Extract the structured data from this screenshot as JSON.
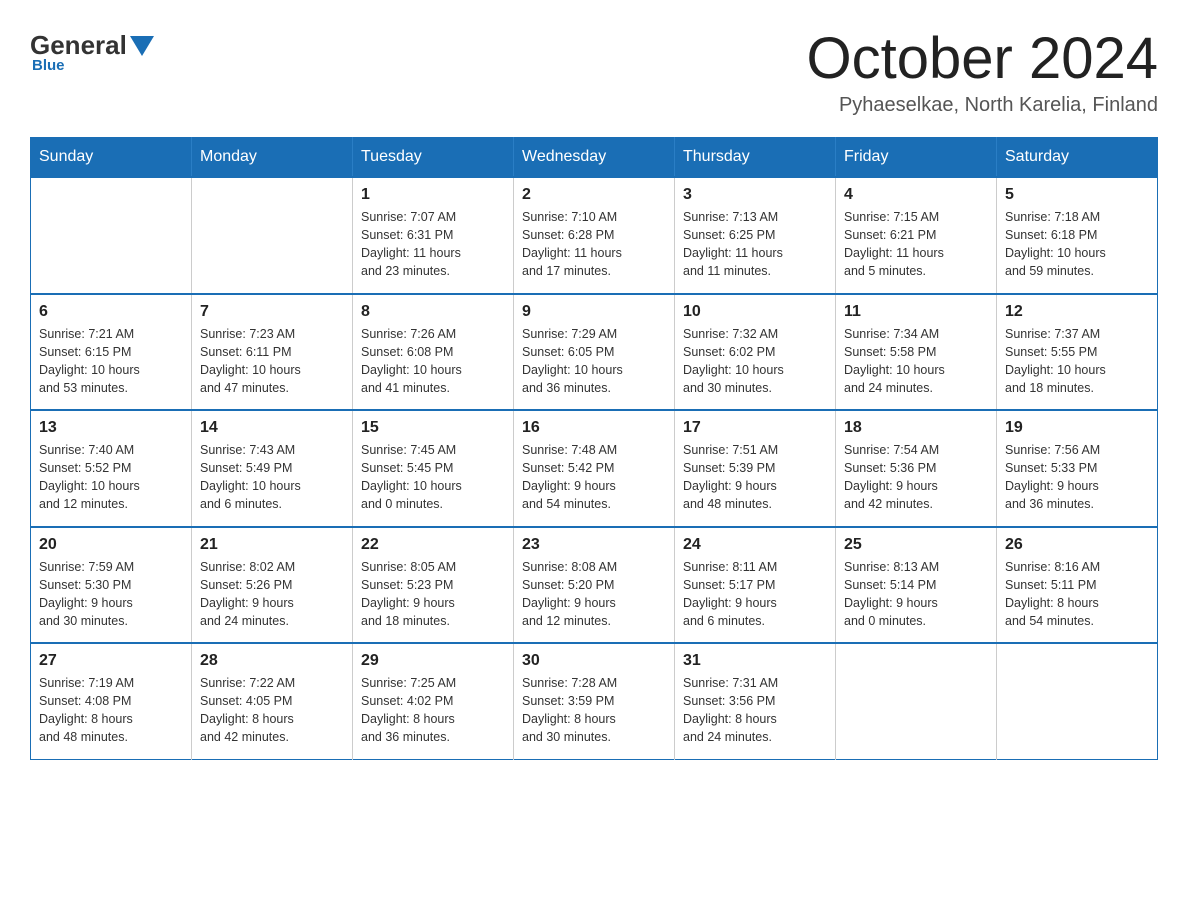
{
  "logo": {
    "general": "General",
    "blue": "Blue",
    "underline": "Blue"
  },
  "title": "October 2024",
  "subtitle": "Pyhaeselkae, North Karelia, Finland",
  "days_of_week": [
    "Sunday",
    "Monday",
    "Tuesday",
    "Wednesday",
    "Thursday",
    "Friday",
    "Saturday"
  ],
  "weeks": [
    [
      {
        "day": "",
        "info": ""
      },
      {
        "day": "",
        "info": ""
      },
      {
        "day": "1",
        "info": "Sunrise: 7:07 AM\nSunset: 6:31 PM\nDaylight: 11 hours\nand 23 minutes."
      },
      {
        "day": "2",
        "info": "Sunrise: 7:10 AM\nSunset: 6:28 PM\nDaylight: 11 hours\nand 17 minutes."
      },
      {
        "day": "3",
        "info": "Sunrise: 7:13 AM\nSunset: 6:25 PM\nDaylight: 11 hours\nand 11 minutes."
      },
      {
        "day": "4",
        "info": "Sunrise: 7:15 AM\nSunset: 6:21 PM\nDaylight: 11 hours\nand 5 minutes."
      },
      {
        "day": "5",
        "info": "Sunrise: 7:18 AM\nSunset: 6:18 PM\nDaylight: 10 hours\nand 59 minutes."
      }
    ],
    [
      {
        "day": "6",
        "info": "Sunrise: 7:21 AM\nSunset: 6:15 PM\nDaylight: 10 hours\nand 53 minutes."
      },
      {
        "day": "7",
        "info": "Sunrise: 7:23 AM\nSunset: 6:11 PM\nDaylight: 10 hours\nand 47 minutes."
      },
      {
        "day": "8",
        "info": "Sunrise: 7:26 AM\nSunset: 6:08 PM\nDaylight: 10 hours\nand 41 minutes."
      },
      {
        "day": "9",
        "info": "Sunrise: 7:29 AM\nSunset: 6:05 PM\nDaylight: 10 hours\nand 36 minutes."
      },
      {
        "day": "10",
        "info": "Sunrise: 7:32 AM\nSunset: 6:02 PM\nDaylight: 10 hours\nand 30 minutes."
      },
      {
        "day": "11",
        "info": "Sunrise: 7:34 AM\nSunset: 5:58 PM\nDaylight: 10 hours\nand 24 minutes."
      },
      {
        "day": "12",
        "info": "Sunrise: 7:37 AM\nSunset: 5:55 PM\nDaylight: 10 hours\nand 18 minutes."
      }
    ],
    [
      {
        "day": "13",
        "info": "Sunrise: 7:40 AM\nSunset: 5:52 PM\nDaylight: 10 hours\nand 12 minutes."
      },
      {
        "day": "14",
        "info": "Sunrise: 7:43 AM\nSunset: 5:49 PM\nDaylight: 10 hours\nand 6 minutes."
      },
      {
        "day": "15",
        "info": "Sunrise: 7:45 AM\nSunset: 5:45 PM\nDaylight: 10 hours\nand 0 minutes."
      },
      {
        "day": "16",
        "info": "Sunrise: 7:48 AM\nSunset: 5:42 PM\nDaylight: 9 hours\nand 54 minutes."
      },
      {
        "day": "17",
        "info": "Sunrise: 7:51 AM\nSunset: 5:39 PM\nDaylight: 9 hours\nand 48 minutes."
      },
      {
        "day": "18",
        "info": "Sunrise: 7:54 AM\nSunset: 5:36 PM\nDaylight: 9 hours\nand 42 minutes."
      },
      {
        "day": "19",
        "info": "Sunrise: 7:56 AM\nSunset: 5:33 PM\nDaylight: 9 hours\nand 36 minutes."
      }
    ],
    [
      {
        "day": "20",
        "info": "Sunrise: 7:59 AM\nSunset: 5:30 PM\nDaylight: 9 hours\nand 30 minutes."
      },
      {
        "day": "21",
        "info": "Sunrise: 8:02 AM\nSunset: 5:26 PM\nDaylight: 9 hours\nand 24 minutes."
      },
      {
        "day": "22",
        "info": "Sunrise: 8:05 AM\nSunset: 5:23 PM\nDaylight: 9 hours\nand 18 minutes."
      },
      {
        "day": "23",
        "info": "Sunrise: 8:08 AM\nSunset: 5:20 PM\nDaylight: 9 hours\nand 12 minutes."
      },
      {
        "day": "24",
        "info": "Sunrise: 8:11 AM\nSunset: 5:17 PM\nDaylight: 9 hours\nand 6 minutes."
      },
      {
        "day": "25",
        "info": "Sunrise: 8:13 AM\nSunset: 5:14 PM\nDaylight: 9 hours\nand 0 minutes."
      },
      {
        "day": "26",
        "info": "Sunrise: 8:16 AM\nSunset: 5:11 PM\nDaylight: 8 hours\nand 54 minutes."
      }
    ],
    [
      {
        "day": "27",
        "info": "Sunrise: 7:19 AM\nSunset: 4:08 PM\nDaylight: 8 hours\nand 48 minutes."
      },
      {
        "day": "28",
        "info": "Sunrise: 7:22 AM\nSunset: 4:05 PM\nDaylight: 8 hours\nand 42 minutes."
      },
      {
        "day": "29",
        "info": "Sunrise: 7:25 AM\nSunset: 4:02 PM\nDaylight: 8 hours\nand 36 minutes."
      },
      {
        "day": "30",
        "info": "Sunrise: 7:28 AM\nSunset: 3:59 PM\nDaylight: 8 hours\nand 30 minutes."
      },
      {
        "day": "31",
        "info": "Sunrise: 7:31 AM\nSunset: 3:56 PM\nDaylight: 8 hours\nand 24 minutes."
      },
      {
        "day": "",
        "info": ""
      },
      {
        "day": "",
        "info": ""
      }
    ]
  ]
}
